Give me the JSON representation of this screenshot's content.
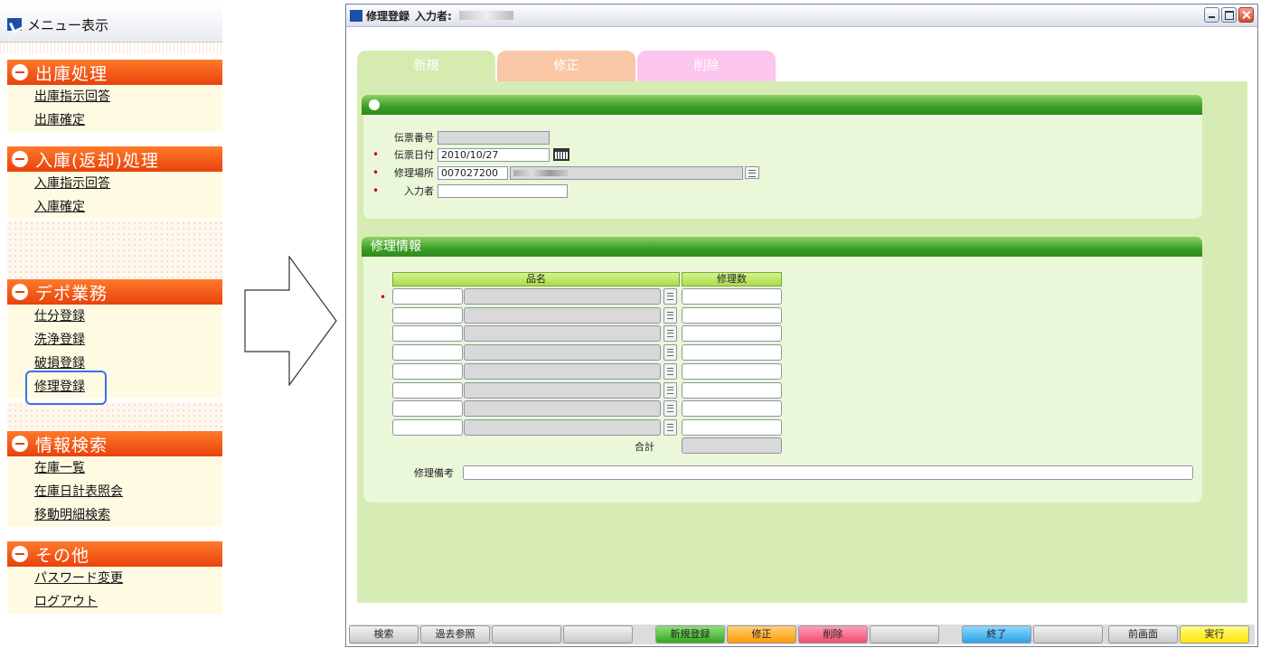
{
  "menu": {
    "title": "メニュー表示",
    "sections": [
      {
        "title": "出庫処理",
        "items": [
          "出庫指示回答",
          "出庫確定"
        ]
      },
      {
        "title": "入庫(返却)処理",
        "items": [
          "入庫指示回答",
          "入庫確定"
        ]
      },
      {
        "title": "デポ業務",
        "items": [
          "仕分登録",
          "洗浄登録",
          "破損登録",
          "修理登録"
        ]
      },
      {
        "title": "情報検索",
        "items": [
          "在庫一覧",
          "在庫日計表照会",
          "移動明細検索"
        ]
      },
      {
        "title": "その他",
        "items": [
          "パスワード変更",
          "ログアウト"
        ]
      }
    ]
  },
  "window": {
    "title": "修理登録",
    "entered_by_label": "入力者:"
  },
  "tabs": [
    "新規",
    "修正",
    "削除"
  ],
  "header_form": {
    "slip_no_label": "伝票番号",
    "slip_date_label": "伝票日付",
    "slip_date_value": "2010/10/27",
    "repair_location_label": "修理場所",
    "repair_location_code": "007027200",
    "entered_by_label": "入力者"
  },
  "repair_info": {
    "title": "修理情報",
    "col_item": "品名",
    "col_qty": "修理数",
    "total_label": "合計",
    "remarks_label": "修理備考",
    "row_count": 8
  },
  "toolbar": [
    {
      "label": "検索",
      "color": "gray"
    },
    {
      "label": "過去参照",
      "color": "gray"
    },
    {
      "label": "",
      "color": "gray"
    },
    {
      "label": "",
      "color": "gray"
    },
    {
      "label": "新規登録",
      "color": "green"
    },
    {
      "label": "修正",
      "color": "orange"
    },
    {
      "label": "削除",
      "color": "pink"
    },
    {
      "label": "",
      "color": "gray"
    },
    {
      "label": "終了",
      "color": "blue"
    },
    {
      "label": "",
      "color": "gray"
    },
    {
      "label": "前画面",
      "color": "gray"
    },
    {
      "label": "実行",
      "color": "yellow"
    }
  ]
}
